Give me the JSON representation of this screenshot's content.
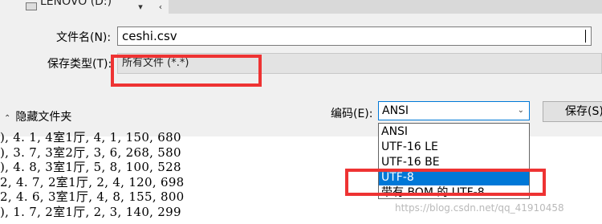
{
  "window": {
    "path": "LENOVO (D:)",
    "nav_down_icon": "▾",
    "nav_back_icon": "‹"
  },
  "form": {
    "file_name_label": "文件名(N):",
    "file_name_value": "ceshi.csv",
    "save_type_label": "保存类型(T):",
    "save_type_value": "所有文件 (*.*)",
    "encoding_label": "编码(E):",
    "encoding_value": "ANSI",
    "save_button_label": "保存(S)"
  },
  "hide_folders": {
    "icon": "⌃",
    "label": "隐藏文件夹"
  },
  "encoding_options": [
    "ANSI",
    "UTF-16 LE",
    "UTF-16 BE",
    "UTF-8",
    "带有 BOM 的 UTF-8"
  ],
  "selected_encoding_option": "UTF-8",
  "background_lines": [
    "), 4. 1, 4室1厅, 4, 1, 150, 680",
    "), 3. 7, 3室2厅, 3, 6, 268, 580",
    "), 4. 8, 3室1厅, 5, 8, 100, 528",
    "2, 4. 7, 2室1厅, 2, 4, 120, 698",
    "2, 4. 6, 3室1厅, 4, 8, 155, 800",
    "), 1. 7, 2室1厅, 2, 3, 140, 299"
  ],
  "watermark": "https://blog.csdn.net/qq_41910458",
  "colors": {
    "highlight_red": "#ee3333",
    "selection_blue": "#0078d7",
    "dialog_bg": "#f0f0f0"
  }
}
